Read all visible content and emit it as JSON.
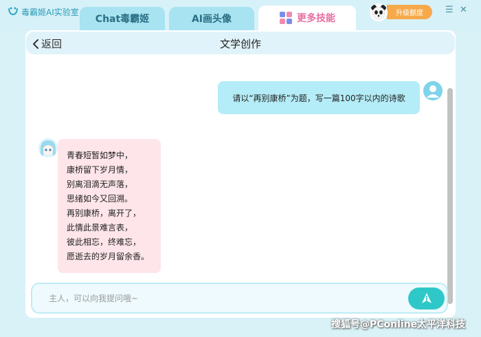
{
  "app": {
    "name": "毒霸姬AI实验室"
  },
  "tabs": [
    {
      "label": "Chat毒霸姬"
    },
    {
      "label": "AI画头像"
    },
    {
      "label": "更多技能"
    }
  ],
  "account": {
    "upgrade_label": "升级额度"
  },
  "window": {
    "minimize": "☰",
    "close": "✕"
  },
  "header": {
    "back_label": "返回",
    "title": "文学创作"
  },
  "chat": {
    "user_message": "请以“再别康桥”为题，写一篇100字以内的诗歌",
    "bot_lines": [
      "青春短暂如梦中，",
      "康桥留下岁月情，",
      "别离泪滴无声落，",
      "思绪如今又回溯。",
      "再别康桥，离开了，",
      "此情此景难言表，",
      "彼此相忘，终难忘，",
      "愿逝去的岁月留余香。"
    ]
  },
  "input": {
    "placeholder": "主人，可以向我提问哦~",
    "value": ""
  },
  "watermark": "搜狐号@PConline太平洋科技",
  "colors": {
    "accent": "#2fc8c8",
    "tab_active_text": "#e86ea0",
    "user_bubble": "#b4ecf7",
    "bot_bubble": "#fde5ea",
    "upgrade": "#f7a94a"
  }
}
